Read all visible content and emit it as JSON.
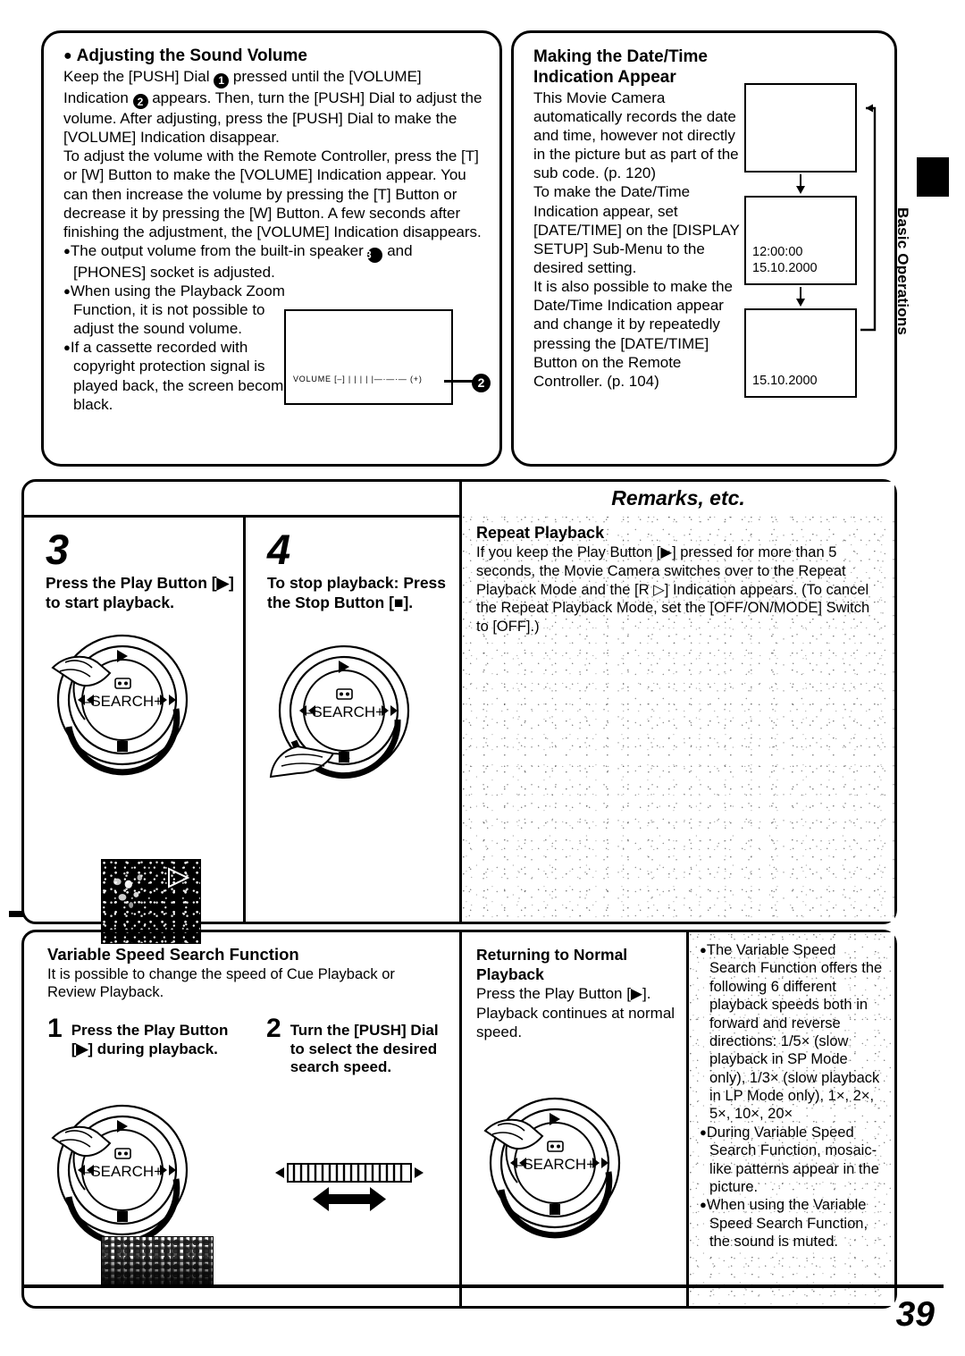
{
  "page": {
    "number": "39",
    "side_tab_label": "Basic Operations"
  },
  "volume_panel": {
    "title": "Adjusting the Sound Volume",
    "paragraph_1_a": "Keep the [PUSH] Dial ",
    "marker_1": "1",
    "paragraph_1_b": " pressed until the [VOLUME] Indication ",
    "marker_2": "2",
    "paragraph_1_c": " appears. Then, turn the [PUSH] Dial to adjust the volume. After adjusting, press the [PUSH] Dial to make the [VOLUME] Indication disappear.",
    "paragraph_2": "To adjust the volume with the Remote Controller, press the [T] or [W] Button to make the [VOLUME] Indication appear. You can then increase the volume by pressing the [T] Button or decrease it by pressing the [W] Button. A few seconds after finishing the adjustment, the [VOLUME] Indication disappears.",
    "bullet_1_a": "The output volume from the built-in speaker ",
    "marker_3": "3",
    "bullet_1_b": " and [PHONES] socket is adjusted.",
    "bullet_2": "When using the Playback Zoom Function, it is not possible to adjust the sound volume.",
    "bullet_3": "If a cassette recorded with copyright protection signal is played back, the screen becomes black.",
    "screen_indication": "VOLUME  [–] | | | | |—·—·— (+)",
    "callout_badge": "2"
  },
  "datetime_panel": {
    "title_line_1": "Making the Date/Time",
    "title_line_2": "Indication Appear",
    "paragraph_1": "This Movie Camera automatically records the date and time, however not directly in the picture but as part of the sub code. (p. 120)",
    "paragraph_2": "To make the Date/Time Indication appear, set [DATE/TIME] on the [DISPLAY SETUP] Sub-Menu to the desired setting.",
    "paragraph_3": "It is also possible to make the Date/Time Indication appear and change it by repeatedly pressing the [DATE/TIME] Button on the Remote Controller. (p. 104)",
    "screens": [
      {
        "line1": "",
        "line2": ""
      },
      {
        "line1": "12:00:00",
        "line2": "15.10.2000"
      },
      {
        "line1": "",
        "line2": "15.10.2000"
      }
    ]
  },
  "steps": [
    {
      "number": "3",
      "text": "Press the Play Button [▶] to start playback.",
      "dial_label": "–SEARCH+"
    },
    {
      "number": "4",
      "text": "To stop playback: Press the Stop Button [■].",
      "dial_label": "–SEARCH+"
    }
  ],
  "remarks": {
    "heading": "Remarks, etc.",
    "title": "Repeat Playback",
    "text": "If you keep the Play Button [▶] pressed for more than 5 seconds, the Movie Camera switches over to the Repeat Playback Mode and the [R ▷] Indication appears. (To cancel the Repeat Playback Mode, set the [OFF/ON/MODE] Switch to [OFF].)"
  },
  "variable_speed": {
    "title": "Variable Speed Search Function",
    "subtitle": "It is possible to change the speed of Cue Playback or Review Playback.",
    "substeps": [
      {
        "number": "1",
        "text": "Press the Play Button [▶] during playback."
      },
      {
        "number": "2",
        "text": "Turn the [PUSH] Dial to select the desired search speed."
      }
    ],
    "dial_label": "–SEARCH+"
  },
  "returning": {
    "title_line_1": "Returning to Normal",
    "title_line_2": "Playback",
    "text_1": "Press the Play Button [▶].",
    "text_2": "Playback continues at normal speed.",
    "dial_label": "–SEARCH+"
  },
  "bottom_remarks": {
    "bullets": [
      "The Variable Speed Search Function offers the following 6 different playback speeds both in forward and reverse directions: 1/5× (slow playback in SP Mode only), 1/3× (slow playback in LP Mode only), 1×, 2×, 5×, 10×, 20×",
      "During Variable Speed Search Function, mosaic-like patterns appear in the picture.",
      "When using the Variable Speed Search Function, the sound is muted."
    ]
  },
  "icons": {
    "play": "▶",
    "stop": "■",
    "rew": "◀◀",
    "ff": "▶▶",
    "repeat_play_outline": "▷"
  }
}
